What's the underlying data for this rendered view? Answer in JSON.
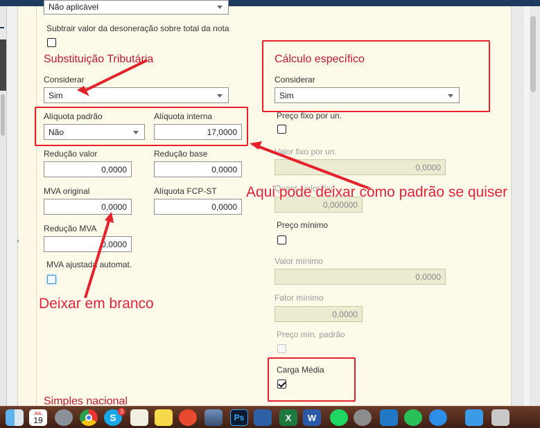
{
  "top": {
    "select_value": "Não aplicável",
    "subtract_label": "Subtrair valor da desoneração sobre total da nota"
  },
  "st": {
    "section_title": "Substituição Tributária",
    "considerar_label": "Considerar",
    "considerar_value": "Sim",
    "aliquota_padrao_label": "Alíquota padrão",
    "aliquota_padrao_value": "Não",
    "aliquota_interna_label": "Alíquota interna",
    "aliquota_interna_value": "17,0000",
    "reducao_valor_label": "Redução valor",
    "reducao_valor_value": "0,0000",
    "reducao_base_label": "Redução base",
    "reducao_base_value": "0,0000",
    "mva_original_label": "MVA original",
    "mva_original_value": "0,0000",
    "aliquota_fcp_label": "Alíquota FCP-ST",
    "aliquota_fcp_value": "0,0000",
    "reducao_mva_label": "Redução MVA",
    "reducao_mva_value": "0,0000",
    "mva_ajustada_label": "MVA ajustada automat."
  },
  "calc": {
    "section_title": "Cálculo específico",
    "considerar_label": "Considerar",
    "considerar_value": "Sim",
    "preco_fixo_label": "Preço fixo por un.",
    "valor_fixo_label": "Valor fixo por un.",
    "valor_fixo_value": "0,0000",
    "quant_valor_fixo_label": "Quant. valor fixo",
    "quant_valor_fixo_value": "0,000000",
    "preco_minimo_label": "Preço mínimo",
    "valor_minimo_label": "Valor mínimo",
    "valor_minimo_value": "0,0000",
    "fator_minimo_label": "Fator mínimo",
    "fator_minimo_value": "0,0000",
    "preco_min_padrao_label": "Preço mín. padrão",
    "carga_media_label": "Carga Média",
    "carga_media_checked": true
  },
  "simples": {
    "section_title": "Simples nacional"
  },
  "annotations": {
    "aqui": "Aqui pode deixar como padrão se quiser",
    "deixar": "Deixar em branco",
    "color": "#e5222b"
  },
  "dock": {
    "items": [
      "finder-icon",
      "calendar-icon",
      "launchpad-icon",
      "chrome-icon",
      "skype-icon",
      "notes-icon",
      "stickies-icon",
      "screen-share-icon",
      "photo-icon",
      "photoshop-icon",
      "virtualbox-icon",
      "excel-icon",
      "word-icon",
      "spotify-icon",
      "system-preferences-icon",
      "vscode-icon",
      "whatsapp-icon",
      "safari-icon",
      "downloads-icon",
      "trash-icon"
    ],
    "calendar_month": "JUL",
    "calendar_day": "19",
    "skype_badge": "3",
    "ps_label": "Ps"
  }
}
